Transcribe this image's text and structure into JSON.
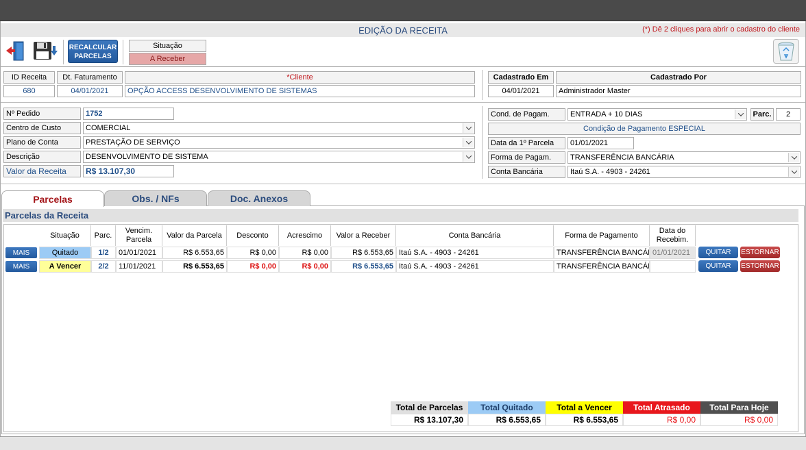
{
  "header": {
    "title": "EDIÇÃO DA RECEITA",
    "hint": "(*) Dê 2 cliques para abrir o cadastro do cliente"
  },
  "toolbar": {
    "exit_icon": "exit-door-icon",
    "save_icon": "floppy-disk-icon",
    "recalc_label_1": "RECALCULAR",
    "recalc_label_2": "PARCELAS",
    "situacao_label": "Situação",
    "situacao_value": "A Receber",
    "trash_icon": "recycle-bin-icon"
  },
  "ids": {
    "id_label": "ID Receita",
    "id_value": "680",
    "dt_label": "Dt. Faturamento",
    "dt_value": "04/01/2021",
    "cliente_label": "*Cliente",
    "cliente_value": "OPÇÃO ACCESS DESENVOLVIMENTO DE SISTEMAS",
    "cad_em_label": "Cadastrado Em",
    "cad_em_value": "04/01/2021",
    "cad_por_label": "Cadastrado Por",
    "cad_por_value": "Administrador Master"
  },
  "form": {
    "pedido_label": "Nº Pedido",
    "pedido_value": "1752",
    "centro_label": "Centro de Custo",
    "centro_value": "COMERCIAL",
    "plano_label": "Plano de Conta",
    "plano_value": "PRESTAÇÃO DE SERVIÇO",
    "desc_label": "Descrição",
    "desc_value": "DESENVOLVIMENTO DE SISTEMA",
    "valor_label": "Valor da Receita",
    "valor_value": "R$ 13.107,30",
    "cond_label": "Cond. de Pagam.",
    "cond_value": "ENTRADA + 10 DIAS",
    "parc_label": "Parc.",
    "parc_value": "2",
    "cond_especial": "Condição de Pagamento ESPECIAL",
    "data1_label": "Data da 1º Parcela",
    "data1_value": "01/01/2021",
    "forma_label": "Forma de Pagam.",
    "forma_value": "TRANSFERÊNCIA BANCÁRIA",
    "conta_label": "Conta Bancária",
    "conta_value": "Itaú S.A. - 4903 - 24261"
  },
  "tabs": [
    "Parcelas",
    "Obs. / NFs",
    "Doc. Anexos"
  ],
  "section_title": "Parcelas da Receita",
  "columns": [
    "Situação",
    "Parc.",
    "Vencim. Parcela",
    "Valor da Parcela",
    "Desconto",
    "Acrescimo",
    "Valor a Receber",
    "Conta Bancária",
    "Forma de Pagamento",
    "Data do Recebim."
  ],
  "rows": [
    {
      "mais": "MAIS",
      "situacao": "Quitado",
      "parc": "1/2",
      "venc": "01/01/2021",
      "valor": "R$ 6.553,65",
      "desconto": "R$ 0,00",
      "acrescimo": "R$ 0,00",
      "receber": "R$ 6.553,65",
      "conta": "Itaú S.A. - 4903 - 24261",
      "forma": "TRANSFERÊNCIA BANCÁRIA",
      "data_rec": "01/01/2021",
      "quitar": "QUITAR",
      "estornar": "ESTORNAR"
    },
    {
      "mais": "MAIS",
      "situacao": "A Vencer",
      "parc": "2/2",
      "venc": "11/01/2021",
      "valor": "R$ 6.553,65",
      "desconto": "R$ 0,00",
      "acrescimo": "R$ 0,00",
      "receber": "R$ 6.553,65",
      "conta": "Itaú S.A. - 4903 - 24261",
      "forma": "TRANSFERÊNCIA BANCÁRIA",
      "data_rec": "",
      "quitar": "QUITAR",
      "estornar": "ESTORNAR"
    }
  ],
  "totals": {
    "parcelas_label": "Total de Parcelas",
    "parcelas_value": "R$ 13.107,30",
    "quitado_label": "Total Quitado",
    "quitado_value": "R$ 6.553,65",
    "vencer_label": "Total a Vencer",
    "vencer_value": "R$ 6.553,65",
    "atrasado_label": "Total Atrasado",
    "atrasado_value": "R$ 0,00",
    "hoje_label": "Total Para Hoje",
    "hoje_value": "R$ 0,00"
  },
  "colors": {
    "quitado": "#9ccbf5",
    "a_vencer": "#ffff99",
    "situacao_receber": "#e6a7a7",
    "atrasado": "#e8171c",
    "hoje": "#505050"
  }
}
